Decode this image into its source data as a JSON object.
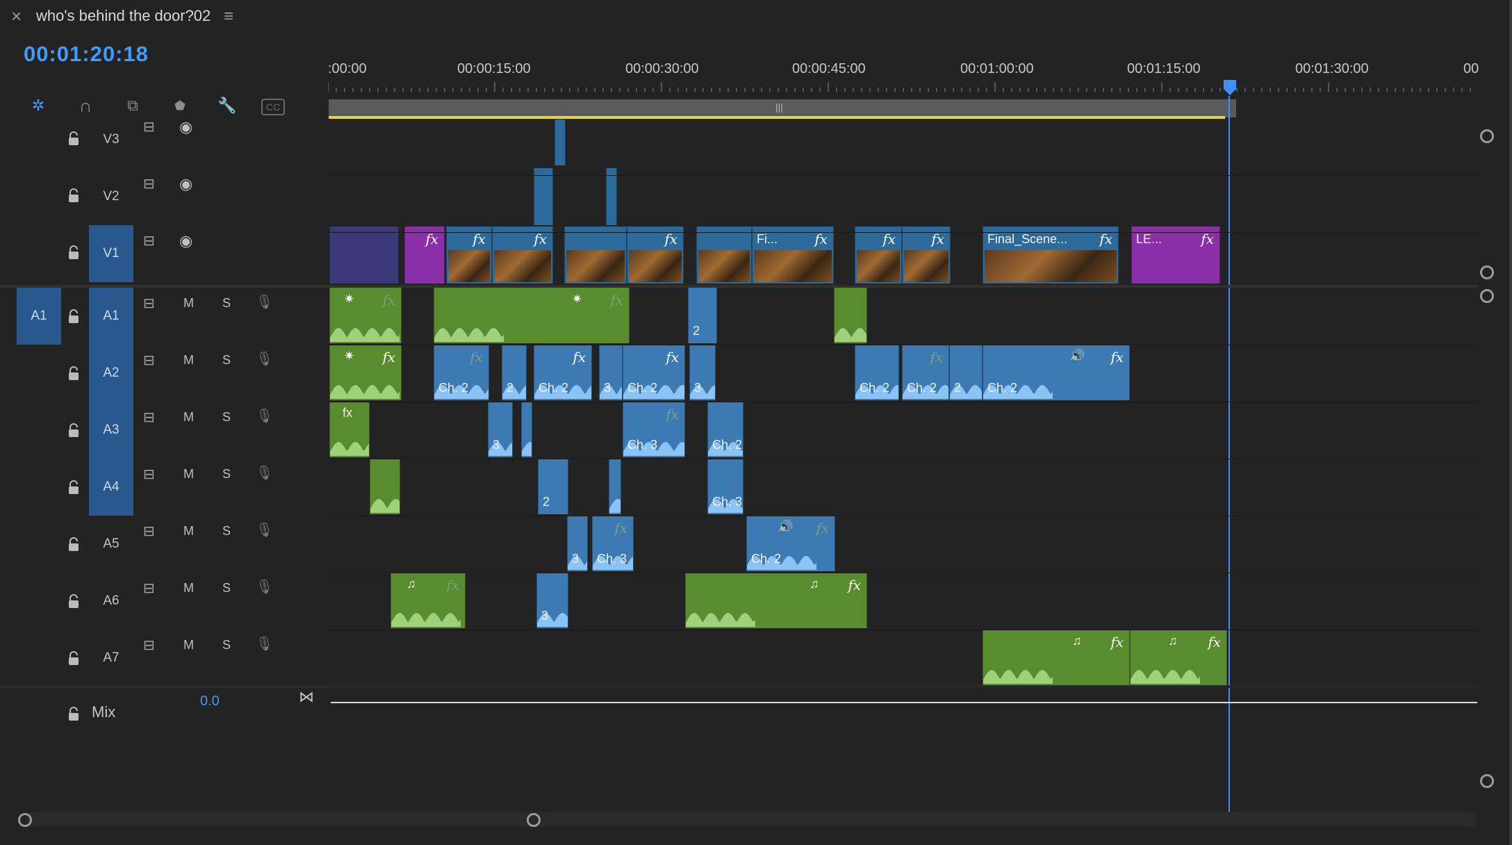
{
  "header": {
    "close_glyph": "×",
    "title": "who's behind the door?02",
    "menu_glyph": "≡"
  },
  "playhead": {
    "timecode": "00:01:20:18"
  },
  "tools": [
    {
      "name": "snap-icon",
      "glyph": "✲",
      "active": true
    },
    {
      "name": "magnet-link-icon",
      "glyph": "∩",
      "active": false
    },
    {
      "name": "linked-selection-icon",
      "glyph": "⧉",
      "active": false
    },
    {
      "name": "marker-icon",
      "glyph": "⬟",
      "active": false
    },
    {
      "name": "wrench-icon",
      "glyph": "🔧",
      "active": false
    },
    {
      "name": "captions-icon",
      "glyph": "CC",
      "active": false
    }
  ],
  "ruler": [
    ":00:00",
    "00:00:15:00",
    "00:00:30:00",
    "00:00:45:00",
    "00:01:00:00",
    "00:01:15:00",
    "00:01:30:00",
    "00"
  ],
  "video_tracks": [
    {
      "name": "V3",
      "targeted": false
    },
    {
      "name": "V2",
      "targeted": false
    },
    {
      "name": "V1",
      "targeted": true
    }
  ],
  "audio_tracks": [
    {
      "name": "A1",
      "source": "A1",
      "m": "M",
      "s": "S"
    },
    {
      "name": "A2",
      "source": "",
      "m": "M",
      "s": "S"
    },
    {
      "name": "A3",
      "source": "",
      "m": "M",
      "s": "S"
    },
    {
      "name": "A4",
      "source": "",
      "m": "M",
      "s": "S"
    },
    {
      "name": "A5",
      "source": "",
      "m": "M",
      "s": "S"
    },
    {
      "name": "A6",
      "source": "",
      "m": "M",
      "s": "S"
    },
    {
      "name": "A7",
      "source": "",
      "m": "M",
      "s": "S"
    }
  ],
  "mix": {
    "label": "Mix",
    "value": "0.0"
  },
  "clip_labels": {
    "v1_fi": "Fi...",
    "v1_final": "Final_Scene...",
    "v1_le": "LE...",
    "fx": "fx",
    "ch2": "Ch. 2",
    "ch3": "Ch. 3",
    "n2": "2",
    "n3": "3",
    "music": "♫",
    "star": "✷",
    "speaker": "🔊"
  },
  "colors": {
    "accent": "#3f9cff",
    "video_clip": "#2c6a9c",
    "audio_green": "#588c2e",
    "audio_blue": "#3d7ab3",
    "purple_clip": "#8b2fa8"
  }
}
